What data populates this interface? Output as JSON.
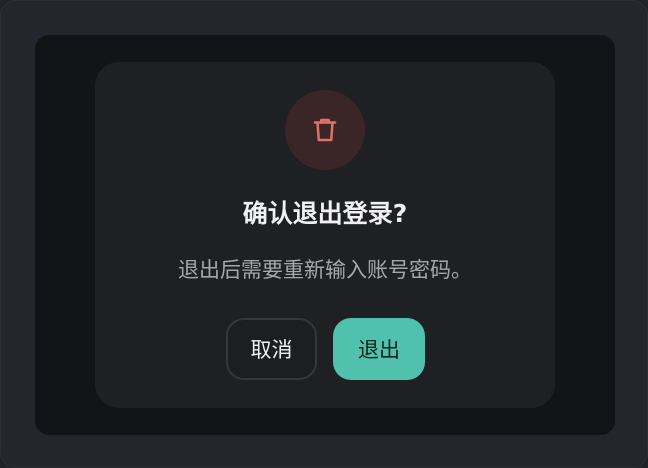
{
  "dialog": {
    "icon": "trash-icon",
    "title": "确认退出登录?",
    "message": "退出后需要重新输入账号密码。",
    "cancel_label": "取消",
    "confirm_label": "退出"
  },
  "colors": {
    "icon_accent": "#e0716a",
    "confirm_button": "#4fc1ad"
  }
}
